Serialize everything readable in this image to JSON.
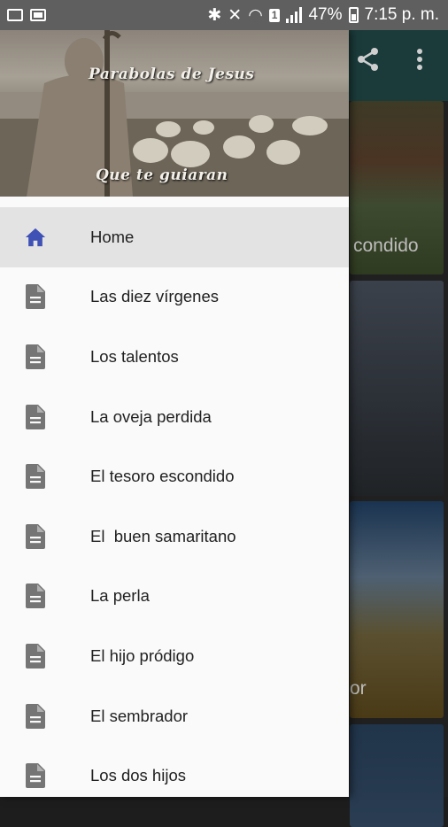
{
  "status_bar": {
    "battery": "47%",
    "time": "7:15 p. m.",
    "sim_badge": "1"
  },
  "drawer": {
    "header_title": "Parabolas de Jesus",
    "header_subtitle": "Que te guiaran",
    "items": [
      {
        "label": "Home",
        "icon": "home-icon",
        "active": true
      },
      {
        "label": "Las diez vírgenes",
        "icon": "document-icon"
      },
      {
        "label": "Los talentos",
        "icon": "document-icon"
      },
      {
        "label": "La oveja perdida",
        "icon": "document-icon"
      },
      {
        "label": "El tesoro escondido",
        "icon": "document-icon"
      },
      {
        "label": "El  buen samaritano",
        "icon": "document-icon"
      },
      {
        "label": "La perla",
        "icon": "document-icon"
      },
      {
        "label": "El hijo pródigo",
        "icon": "document-icon"
      },
      {
        "label": "El sembrador",
        "icon": "document-icon"
      },
      {
        "label": "Los dos hijos",
        "icon": "document-icon"
      }
    ]
  },
  "background": {
    "card_label_1": "condido",
    "card_label_3": "or"
  },
  "colors": {
    "accent": "#3f51b5",
    "drawer_bg": "#fafafa",
    "active_row": "#e3e3e3",
    "icon_grey": "#757575"
  }
}
